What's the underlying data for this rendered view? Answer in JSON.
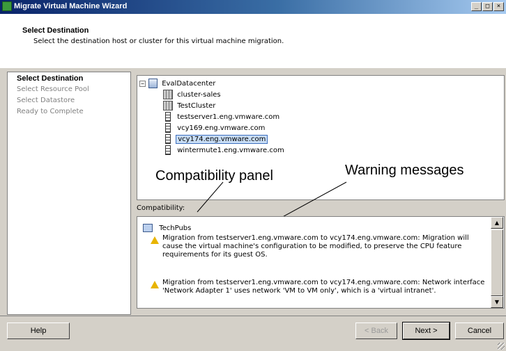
{
  "window": {
    "title": "Migrate Virtual Machine Wizard",
    "controls": {
      "minimize": "_",
      "maximize": "□",
      "close": "×"
    }
  },
  "header": {
    "title": "Select Destination",
    "description": "Select the destination host or cluster for this virtual machine migration."
  },
  "steps": [
    {
      "label": "Select Destination",
      "active": true
    },
    {
      "label": "Select Resource Pool",
      "active": false
    },
    {
      "label": "Select Datastore",
      "active": false
    },
    {
      "label": "Ready to Complete",
      "active": false
    }
  ],
  "tree": {
    "expander": "−",
    "root": {
      "label": "EvalDatacenter",
      "icon": "datacenter-icon"
    },
    "children": [
      {
        "label": "cluster-sales",
        "icon": "cluster-icon",
        "selected": false
      },
      {
        "label": "TestCluster",
        "icon": "cluster-icon",
        "selected": false
      },
      {
        "label": "testserver1.eng.vmware.com",
        "icon": "host-icon",
        "selected": false
      },
      {
        "label": "vcy169.eng.vmware.com",
        "icon": "host-icon",
        "selected": false
      },
      {
        "label": "vcy174.eng.vmware.com",
        "icon": "host-icon",
        "selected": true
      },
      {
        "label": "wintermute1.eng.vmware.com",
        "icon": "host-icon",
        "selected": false
      }
    ]
  },
  "annotations": {
    "compat_panel": "Compatibility panel",
    "warning_messages": "Warning messages"
  },
  "compatibility": {
    "label": "Compatibility:",
    "vm_name": "TechPubs",
    "warnings": [
      "Migration from testserver1.eng.vmware.com to vcy174.eng.vmware.com: Migration will cause the virtual machine's configuration to be modified, to preserve the CPU feature requirements for its guest OS.",
      "Migration from testserver1.eng.vmware.com to vcy174.eng.vmware.com: Network interface 'Network Adapter 1' uses network 'VM to VM only', which is a 'virtual intranet'."
    ]
  },
  "footer": {
    "help": "Help",
    "back": "< Back",
    "next": "Next >",
    "cancel": "Cancel"
  }
}
